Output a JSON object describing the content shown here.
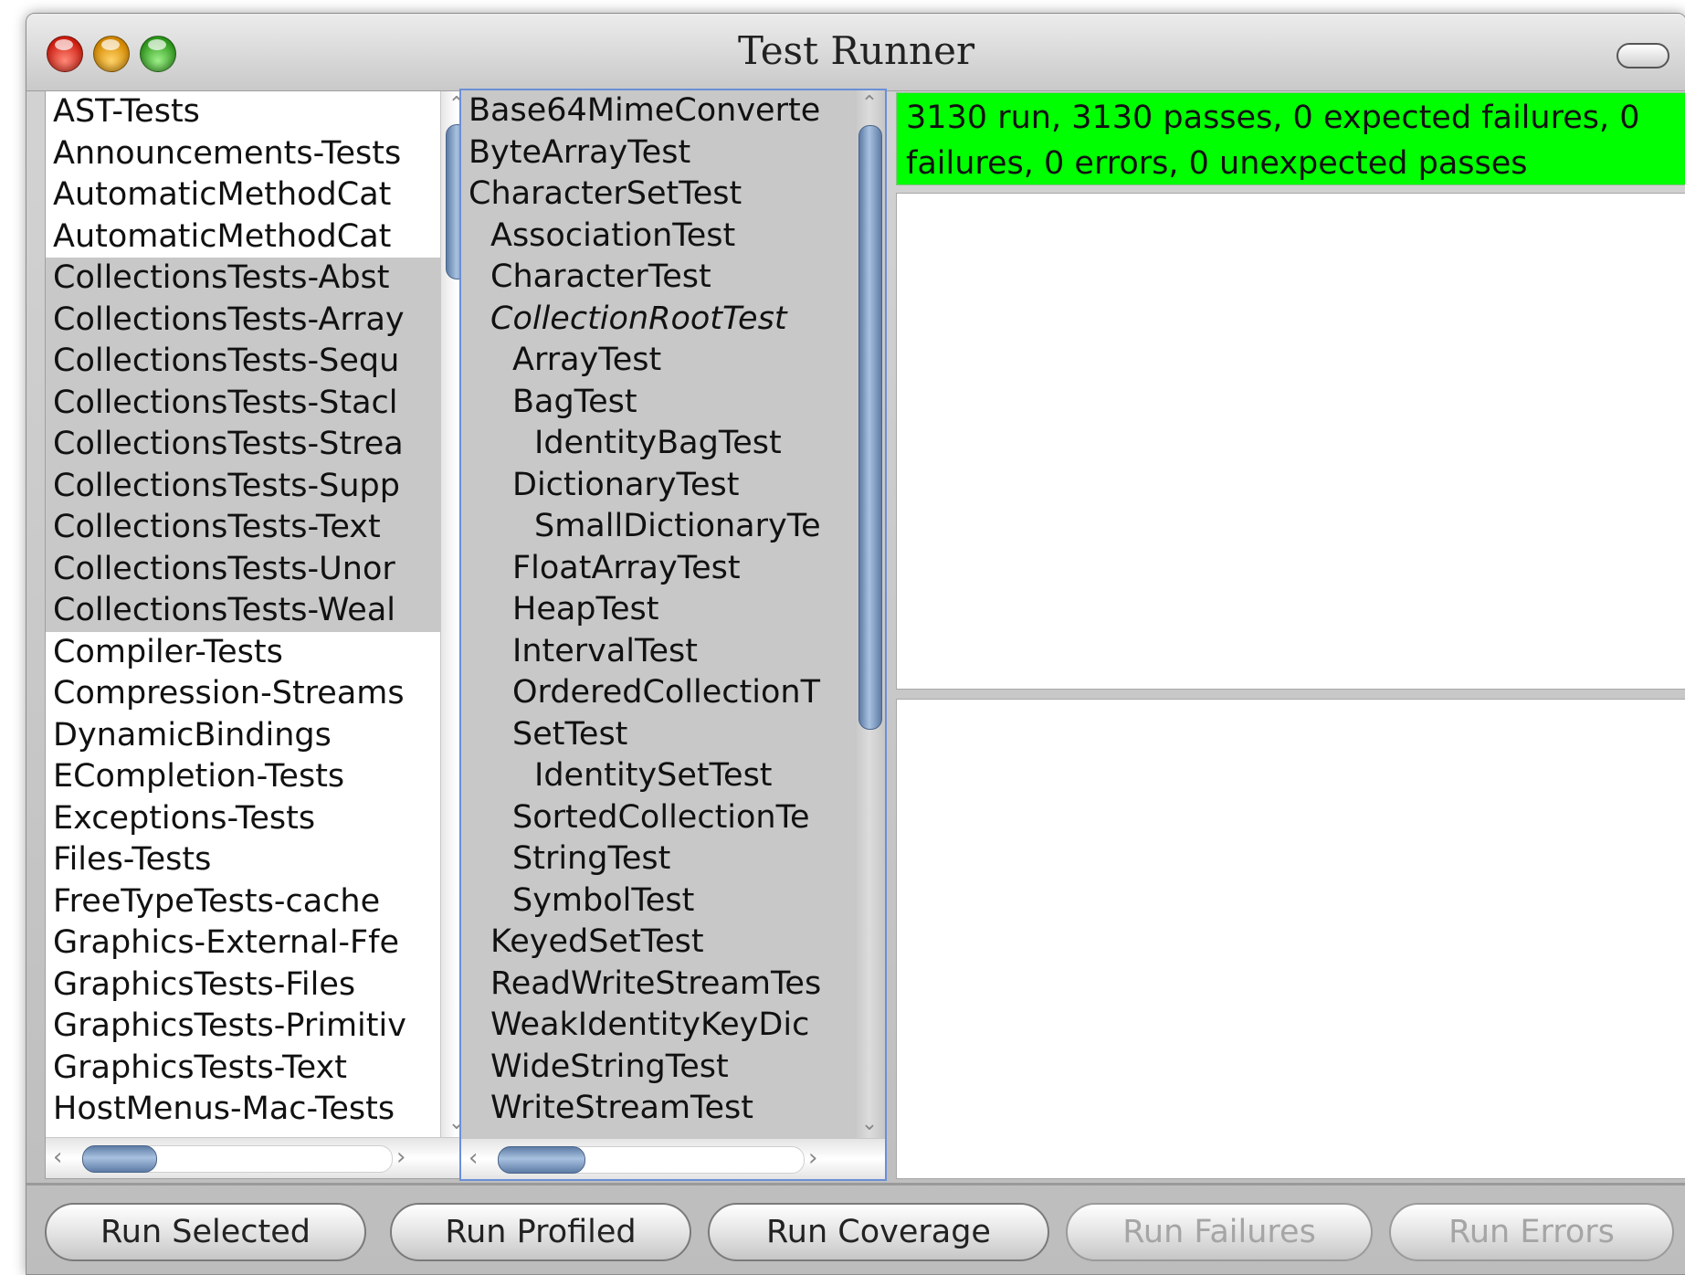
{
  "window": {
    "title": "Test Runner"
  },
  "categories": [
    {
      "label": "AST-Tests",
      "selected": false
    },
    {
      "label": "Announcements-Tests",
      "selected": false
    },
    {
      "label": "AutomaticMethodCat",
      "selected": false
    },
    {
      "label": "AutomaticMethodCat",
      "selected": false
    },
    {
      "label": "CollectionsTests-Abst",
      "selected": true
    },
    {
      "label": "CollectionsTests-Array",
      "selected": true
    },
    {
      "label": "CollectionsTests-Sequ",
      "selected": true
    },
    {
      "label": "CollectionsTests-Stacl",
      "selected": true
    },
    {
      "label": "CollectionsTests-Strea",
      "selected": true
    },
    {
      "label": "CollectionsTests-Supp",
      "selected": true
    },
    {
      "label": "CollectionsTests-Text",
      "selected": true
    },
    {
      "label": "CollectionsTests-Unor",
      "selected": true
    },
    {
      "label": "CollectionsTests-Weal",
      "selected": true
    },
    {
      "label": "Compiler-Tests",
      "selected": false
    },
    {
      "label": "Compression-Streams",
      "selected": false
    },
    {
      "label": "DynamicBindings",
      "selected": false
    },
    {
      "label": "ECompletion-Tests",
      "selected": false
    },
    {
      "label": "Exceptions-Tests",
      "selected": false
    },
    {
      "label": "Files-Tests",
      "selected": false
    },
    {
      "label": "FreeTypeTests-cache",
      "selected": false
    },
    {
      "label": "Graphics-External-Ffe",
      "selected": false
    },
    {
      "label": "GraphicsTests-Files",
      "selected": false
    },
    {
      "label": "GraphicsTests-Primitiv",
      "selected": false
    },
    {
      "label": "GraphicsTests-Text",
      "selected": false
    },
    {
      "label": "HostMenus-Mac-Tests",
      "selected": false
    }
  ],
  "classes": [
    {
      "label": "Base64MimeConverte",
      "depth": 0,
      "italic": false
    },
    {
      "label": "ByteArrayTest",
      "depth": 0,
      "italic": false
    },
    {
      "label": "CharacterSetTest",
      "depth": 0,
      "italic": false
    },
    {
      "label": "AssociationTest",
      "depth": 1,
      "italic": false
    },
    {
      "label": "CharacterTest",
      "depth": 1,
      "italic": false
    },
    {
      "label": "CollectionRootTest",
      "depth": 1,
      "italic": true
    },
    {
      "label": "ArrayTest",
      "depth": 2,
      "italic": false
    },
    {
      "label": "BagTest",
      "depth": 2,
      "italic": false
    },
    {
      "label": "IdentityBagTest",
      "depth": 3,
      "italic": false
    },
    {
      "label": "DictionaryTest",
      "depth": 2,
      "italic": false
    },
    {
      "label": "SmallDictionaryTe",
      "depth": 3,
      "italic": false
    },
    {
      "label": "FloatArrayTest",
      "depth": 2,
      "italic": false
    },
    {
      "label": "HeapTest",
      "depth": 2,
      "italic": false
    },
    {
      "label": "IntervalTest",
      "depth": 2,
      "italic": false
    },
    {
      "label": "OrderedCollectionT",
      "depth": 2,
      "italic": false
    },
    {
      "label": "SetTest",
      "depth": 2,
      "italic": false
    },
    {
      "label": "IdentitySetTest",
      "depth": 3,
      "italic": false
    },
    {
      "label": "SortedCollectionTe",
      "depth": 2,
      "italic": false
    },
    {
      "label": "StringTest",
      "depth": 2,
      "italic": false
    },
    {
      "label": "SymbolTest",
      "depth": 2,
      "italic": false
    },
    {
      "label": "KeyedSetTest",
      "depth": 1,
      "italic": false
    },
    {
      "label": "ReadWriteStreamTes",
      "depth": 1,
      "italic": false
    },
    {
      "label": "WeakIdentityKeyDic",
      "depth": 1,
      "italic": false
    },
    {
      "label": "WideStringTest",
      "depth": 1,
      "italic": false
    },
    {
      "label": "WriteStreamTest",
      "depth": 1,
      "italic": false
    }
  ],
  "status": {
    "text": "3130 run, 3130 passes, 0 expected failures, 0 failures, 0 errors, 0 unexpected passes",
    "color": "#00ff00"
  },
  "buttons": {
    "run_selected": "Run Selected",
    "run_profiled": "Run Profiled",
    "run_coverage": "Run Coverage",
    "run_failures": "Run Failures",
    "run_errors": "Run Errors"
  },
  "icons": {
    "up": "scroll-up-arrow-icon",
    "down": "scroll-down-arrow-icon",
    "left": "scroll-left-arrow-icon",
    "right": "scroll-right-arrow-icon"
  }
}
